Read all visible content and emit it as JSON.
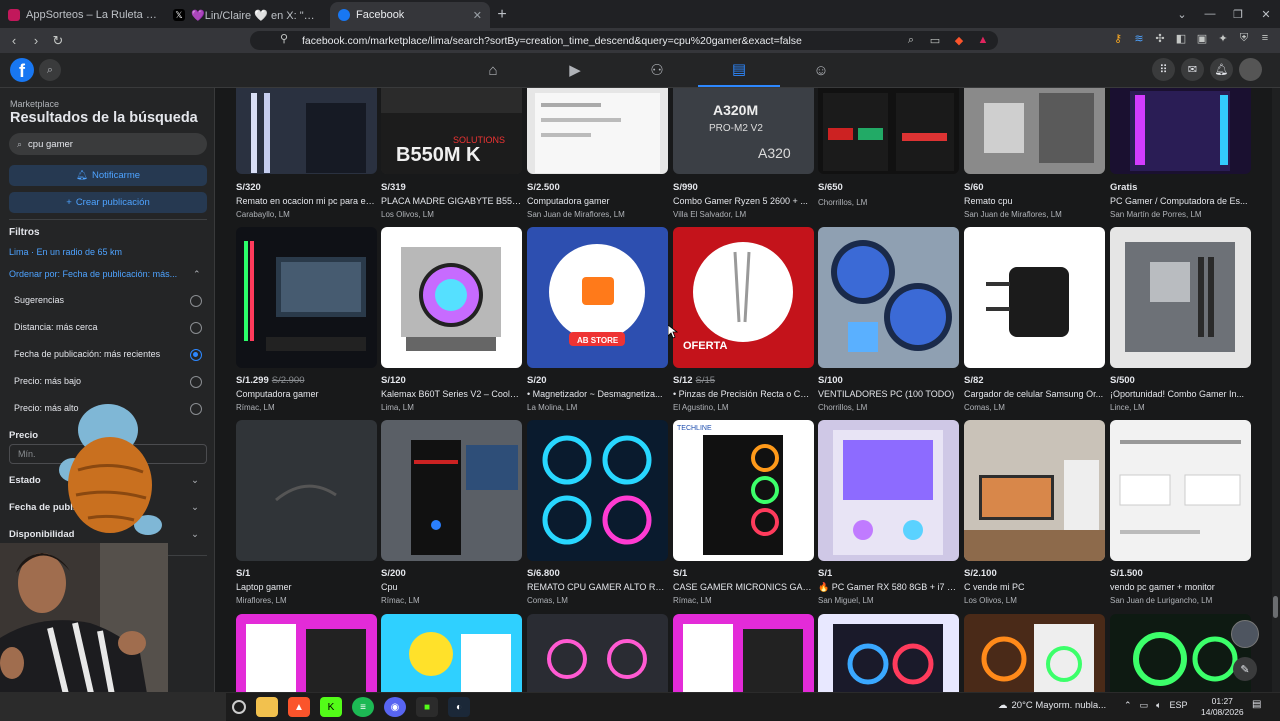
{
  "browser": {
    "tabs": [
      {
        "title": "AppSorteos – La Ruleta de la Suerte",
        "icon_color": "#c2185b"
      },
      {
        "title": "💜Lin/Claire 🤍 en X: \"Mothafucka,",
        "icon_color": "#000000"
      },
      {
        "title": "Facebook",
        "icon_color": "#1877f2"
      }
    ],
    "url": "facebook.com/marketplace/lima/search?sortBy=creation_time_descend&query=cpu%20gamer&exact=false"
  },
  "fb": {
    "logo": "f",
    "nav": [
      "home-icon",
      "watch-icon",
      "friends-icon",
      "marketplace-icon",
      "groups-icon"
    ]
  },
  "sidebar": {
    "breadcrumb": "Marketplace",
    "title": "Resultados de la búsqueda",
    "search_value": "cpu gamer",
    "notify_label": "Notificarme",
    "create_label": "Crear publicación",
    "filters_heading": "Filtros",
    "location_link": "Lima · En un radio de 65 km",
    "sort_link": "Ordenar por: Fecha de publicación: más...",
    "sort_options": [
      {
        "label": "Sugerencias",
        "selected": false
      },
      {
        "label": "Distancia: más cerca",
        "selected": false
      },
      {
        "label": "Fecha de publicación: más recientes",
        "selected": true
      },
      {
        "label": "Precio: más bajo",
        "selected": false
      },
      {
        "label": "Precio: más alto",
        "selected": false
      }
    ],
    "price_heading": "Precio",
    "price_min_placeholder": "Mín.",
    "sections": [
      "Estado",
      "Fecha de publicación",
      "Disponibilidad"
    ]
  },
  "listings": [
    {
      "price": "S/320",
      "old_price": "",
      "title": "Remato en ocacion mi pc para es...",
      "location": "Carabayllo, LM"
    },
    {
      "price": "S/319",
      "old_price": "",
      "title": "PLACA MADRE GIGABYTE B550...",
      "location": "Los Olivos, LM"
    },
    {
      "price": "S/2.500",
      "old_price": "",
      "title": "Computadora gamer",
      "location": "San Juan de Miraflores, LM"
    },
    {
      "price": "S/990",
      "old_price": "",
      "title": "Combo Gamer Ryzen 5 2600 + ...",
      "location": "Villa El Salvador, LM"
    },
    {
      "price": "S/650",
      "old_price": "",
      "title": "",
      "location": "Chorrillos, LM"
    },
    {
      "price": "S/60",
      "old_price": "",
      "title": "Remato cpu",
      "location": "San Juan de Miraflores, LM"
    },
    {
      "price": "Gratis",
      "old_price": "",
      "title": "PC Gamer / Computadora de Es...",
      "location": "San Martín de Porres, LM"
    },
    {
      "price": "S/1.299",
      "old_price": "S/2.900",
      "title": "Computadora gamer",
      "location": "Rímac, LM"
    },
    {
      "price": "S/120",
      "old_price": "",
      "title": "Kalemax B60T Series V2 – Cooler...",
      "location": "Lima, LM"
    },
    {
      "price": "S/20",
      "old_price": "",
      "title": "• Magnetizador ~ Desmagnetiza...",
      "location": "La Molina, LM"
    },
    {
      "price": "S/12",
      "old_price": "S/15",
      "title": "• Pinzas de Precisión Recta o Cur...",
      "location": "El Agustino, LM"
    },
    {
      "price": "S/100",
      "old_price": "",
      "title": "VENTILADORES PC (100 TODO)",
      "location": "Chorrillos, LM"
    },
    {
      "price": "S/82",
      "old_price": "",
      "title": "Cargador de celular Samsung Or...",
      "location": "Comas, LM"
    },
    {
      "price": "S/500",
      "old_price": "",
      "title": "¡Oportunidad! Combo Gamer In...",
      "location": "Lince, LM"
    },
    {
      "price": "S/1",
      "old_price": "",
      "title": "Laptop gamer",
      "location": "Miraflores, LM"
    },
    {
      "price": "S/200",
      "old_price": "",
      "title": "Cpu",
      "location": "Rímac, LM"
    },
    {
      "price": "S/6.800",
      "old_price": "",
      "title": "REMATO CPU GAMER ALTO REN...",
      "location": "Comas, LM"
    },
    {
      "price": "S/1",
      "old_price": "",
      "title": "CASE GAMER MICRONICS GAM...",
      "location": "Rímac, LM"
    },
    {
      "price": "S/1",
      "old_price": "",
      "title": "🔥 PC Gamer RX 580 8GB + i7 4...",
      "location": "San Miguel, LM"
    },
    {
      "price": "S/2.100",
      "old_price": "",
      "title": "C vende mi PC",
      "location": "Los Olivos, LM"
    },
    {
      "price": "S/1.500",
      "old_price": "",
      "title": "vendo pc gamer + monitor",
      "location": "San Juan de Lurigancho, LM"
    }
  ],
  "taskbar": {
    "weather": "20°C  Mayorm. nubla...",
    "lang": "ESP",
    "time": "01:27",
    "date": "14/08/2026"
  }
}
